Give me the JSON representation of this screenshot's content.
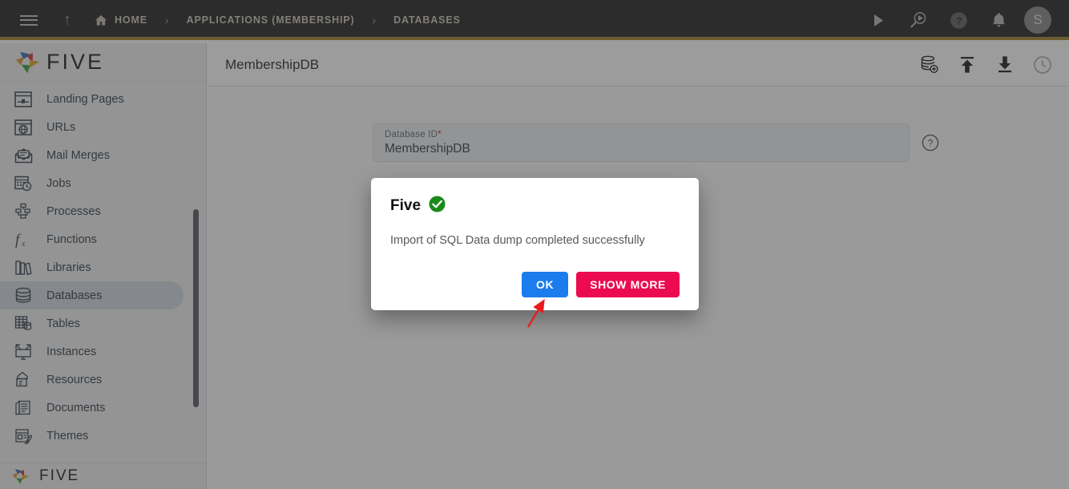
{
  "topnav": {
    "menu_icon": "hamburger-icon",
    "up_icon": "arrow-up-icon",
    "breadcrumbs": [
      {
        "label": "HOME",
        "icon": "home-icon"
      },
      {
        "label": "APPLICATIONS (MEMBERSHIP)",
        "icon": ""
      },
      {
        "label": "DATABASES",
        "icon": ""
      }
    ],
    "separator": "›",
    "actions": [
      {
        "name": "run-icon",
        "title": "Run"
      },
      {
        "name": "debug-search-icon",
        "title": "Run with debug"
      },
      {
        "name": "help-icon",
        "title": "Help"
      },
      {
        "name": "notifications-bell-icon",
        "title": "Notifications"
      }
    ],
    "avatar_initial": "S",
    "accent_bar_color": "#9a7b1c",
    "background_color": "#161616"
  },
  "sidebar": {
    "logo_text": "FIVE",
    "footer_logo_text": "FIVE",
    "items": [
      {
        "label": "Landing Pages",
        "icon": "landing-page-icon",
        "active": false
      },
      {
        "label": "URLs",
        "icon": "globe-window-icon",
        "active": false
      },
      {
        "label": "Mail Merges",
        "icon": "mail-merge-icon",
        "active": false
      },
      {
        "label": "Jobs",
        "icon": "calendar-clock-icon",
        "active": false
      },
      {
        "label": "Processes",
        "icon": "flowchart-icon",
        "active": false
      },
      {
        "label": "Functions",
        "icon": "function-fx-icon",
        "active": false
      },
      {
        "label": "Libraries",
        "icon": "books-icon",
        "active": false
      },
      {
        "label": "Databases",
        "icon": "database-icon",
        "active": true
      },
      {
        "label": "Tables",
        "icon": "table-icon",
        "active": false
      },
      {
        "label": "Instances",
        "icon": "monitor-instance-icon",
        "active": false
      },
      {
        "label": "Resources",
        "icon": "resources-icon",
        "active": false
      },
      {
        "label": "Documents",
        "icon": "documents-icon",
        "active": false
      },
      {
        "label": "Themes",
        "icon": "themes-icon",
        "active": false
      }
    ]
  },
  "main": {
    "title": "MembershipDB",
    "toolbar": [
      {
        "name": "add-database-icon",
        "disabled": false
      },
      {
        "name": "upload-icon",
        "disabled": false
      },
      {
        "name": "download-icon",
        "disabled": false
      },
      {
        "name": "history-clock-icon",
        "disabled": true
      }
    ],
    "field": {
      "label": "Database ID",
      "required_mark": "*",
      "value": "MembershipDB",
      "placeholder": "Database ID",
      "help_icon": "help-question-icon"
    }
  },
  "dialog": {
    "title": "Five",
    "status_icon": "success-check-icon",
    "status_color": "#1a8a1a",
    "message": "Import of SQL Data dump completed successfully",
    "buttons": [
      {
        "label": "OK",
        "name": "ok-button",
        "color": "#1b7ced"
      },
      {
        "label": "SHOW MORE",
        "name": "show-more-button",
        "color": "#ec0a50"
      }
    ]
  },
  "annotation": {
    "arrow_color": "#e81c1c",
    "points_to": "ok-button"
  }
}
